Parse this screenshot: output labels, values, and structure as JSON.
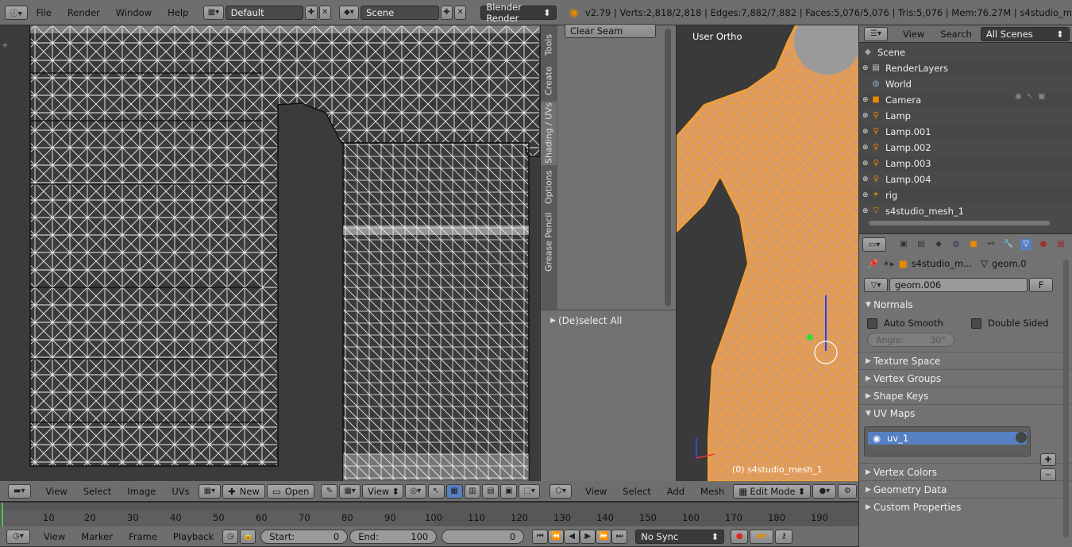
{
  "top": {
    "menus": [
      "File",
      "Render",
      "Window",
      "Help"
    ],
    "layout": "Default",
    "scene": "Scene",
    "engine": "Blender Render",
    "stats": "v2.79 | Verts:2,818/2,818 | Edges:7,882/7,882 | Faces:5,076/5,076 | Tris:5,076 | Mem:76.27M | s4studio_m"
  },
  "uv_header": {
    "menus": [
      "View",
      "Select",
      "Image",
      "UVs"
    ],
    "new_label": "New",
    "open_label": "Open",
    "view_label": "View"
  },
  "tools": {
    "tabs": [
      "Tools",
      "Create",
      "Shading / UVs",
      "Options",
      "Grease Pencil"
    ],
    "clear_seam": "Clear Seam",
    "deselect_all": "(De)select All"
  },
  "viewport": {
    "label": "User Ortho",
    "object_label": "(0) s4studio_mesh_1",
    "menus": [
      "View",
      "Select",
      "Add",
      "Mesh"
    ],
    "mode": "Edit Mode"
  },
  "outliner": {
    "menus": [
      "View",
      "Search"
    ],
    "filter": "All Scenes",
    "items": [
      {
        "label": "Scene",
        "color": "#ddd"
      },
      {
        "label": "RenderLayers",
        "color": "#ddd"
      },
      {
        "label": "World",
        "color": "#ddd"
      },
      {
        "label": "Camera",
        "color": "#ddd"
      },
      {
        "label": "Lamp",
        "color": "#ddd"
      },
      {
        "label": "Lamp.001",
        "color": "#ddd"
      },
      {
        "label": "Lamp.002",
        "color": "#ddd"
      },
      {
        "label": "Lamp.003",
        "color": "#ddd"
      },
      {
        "label": "Lamp.004",
        "color": "#ddd"
      },
      {
        "label": "rig",
        "color": "#ddd"
      },
      {
        "label": "s4studio_mesh_1",
        "color": "#ddd"
      }
    ]
  },
  "properties": {
    "breadcrumb_obj": "s4studio_m...",
    "breadcrumb_data": "geom.0",
    "mesh_name": "geom.006",
    "fake_user": "F",
    "normals": "Normals",
    "auto_smooth": "Auto Smooth",
    "double_sided": "Double Sided",
    "angle_label": "Angle:",
    "angle_value": "30°",
    "panels_a": [
      "Texture Space",
      "Vertex Groups",
      "Shape Keys"
    ],
    "uv_maps": "UV Maps",
    "uv_map_item": "uv_1",
    "panels_b": [
      "Vertex Colors",
      "Geometry Data",
      "Custom Properties"
    ]
  },
  "timeline": {
    "ticks": [
      "10",
      "20",
      "30",
      "40",
      "50",
      "60",
      "70",
      "80",
      "90",
      "100",
      "110",
      "120",
      "130",
      "140",
      "150",
      "160",
      "170",
      "180",
      "190"
    ],
    "menus": [
      "View",
      "Marker",
      "Frame",
      "Playback"
    ],
    "start_label": "Start:",
    "start_value": "0",
    "end_label": "End:",
    "end_value": "100",
    "current": "0",
    "sync": "No Sync"
  },
  "colors": {
    "accent": "#e68a00",
    "selected": "#5680c2",
    "mesh": "#f5a030"
  }
}
